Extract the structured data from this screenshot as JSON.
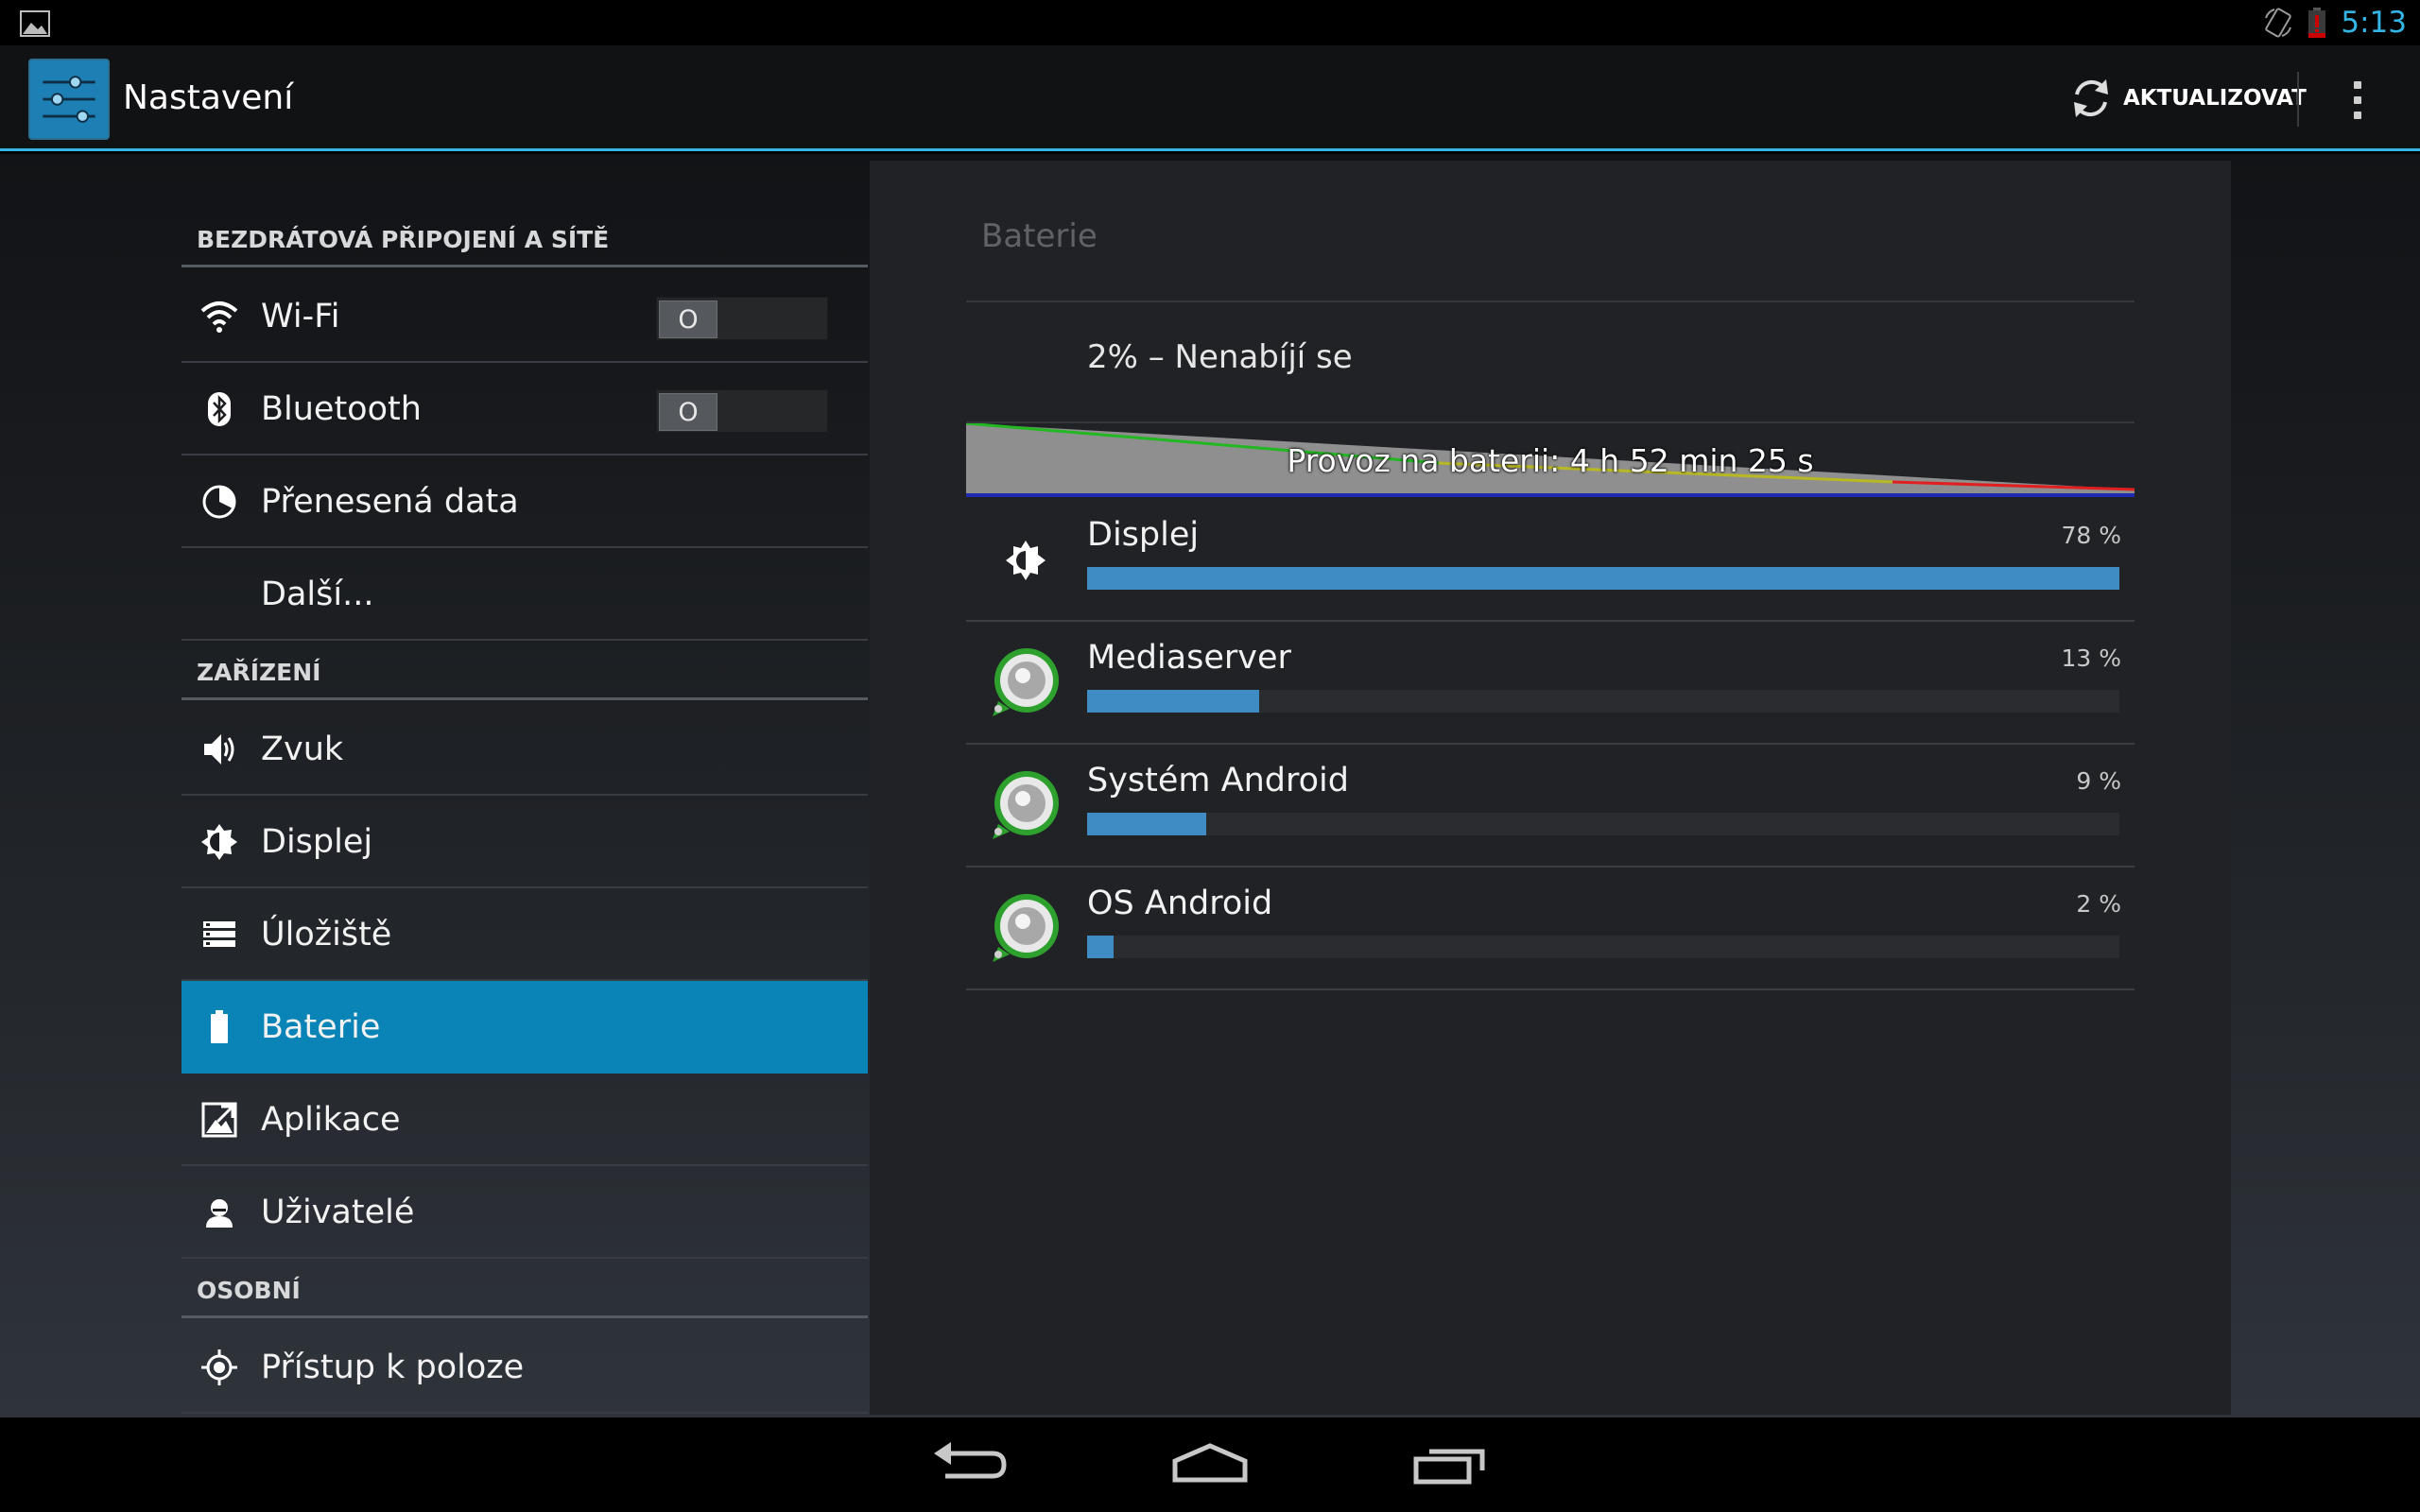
{
  "status_bar": {
    "time": "5:13"
  },
  "action_bar": {
    "title": "Nastavení",
    "refresh_label": "AKTUALIZOVAT"
  },
  "sidebar": {
    "sections": [
      {
        "header": "BEZDRÁTOVÁ PŘIPOJENÍ A SÍTĚ"
      },
      {
        "header": "ZAŘÍZENÍ"
      },
      {
        "header": "OSOBNÍ"
      }
    ],
    "items": [
      {
        "label": "Wi-Fi",
        "icon": "wifi-icon",
        "toggle": "O"
      },
      {
        "label": "Bluetooth",
        "icon": "bluetooth-icon",
        "toggle": "O"
      },
      {
        "label": "Přenesená data",
        "icon": "data-usage-icon"
      },
      {
        "label": "Další...",
        "icon": ""
      },
      {
        "label": "Zvuk",
        "icon": "speaker-icon"
      },
      {
        "label": "Displej",
        "icon": "brightness-icon"
      },
      {
        "label": "Úložiště",
        "icon": "storage-icon"
      },
      {
        "label": "Baterie",
        "icon": "battery-icon",
        "selected": true
      },
      {
        "label": "Aplikace",
        "icon": "apps-icon"
      },
      {
        "label": "Uživatelé",
        "icon": "user-icon"
      },
      {
        "label": "Přístup k poloze",
        "icon": "location-icon"
      }
    ]
  },
  "battery": {
    "title": "Baterie",
    "status": "2% – Nenabíjí se",
    "graph_label": "Provoz na baterii: 4 h 52 min 25 s",
    "apps": [
      {
        "name": "Displej",
        "percent_text": "78 %",
        "percent": 78,
        "icon": "brightness-icon"
      },
      {
        "name": "Mediaserver",
        "percent_text": "13 %",
        "percent": 13,
        "icon": "android-app-icon"
      },
      {
        "name": "Systém Android",
        "percent_text": "9 %",
        "percent": 9,
        "icon": "android-app-icon"
      },
      {
        "name": "OS Android",
        "percent_text": "2 %",
        "percent": 2,
        "icon": "android-app-icon"
      }
    ]
  },
  "colors": {
    "accent": "#33b5e5",
    "selected": "#0a84b6",
    "bar": "#3f8cc4"
  }
}
